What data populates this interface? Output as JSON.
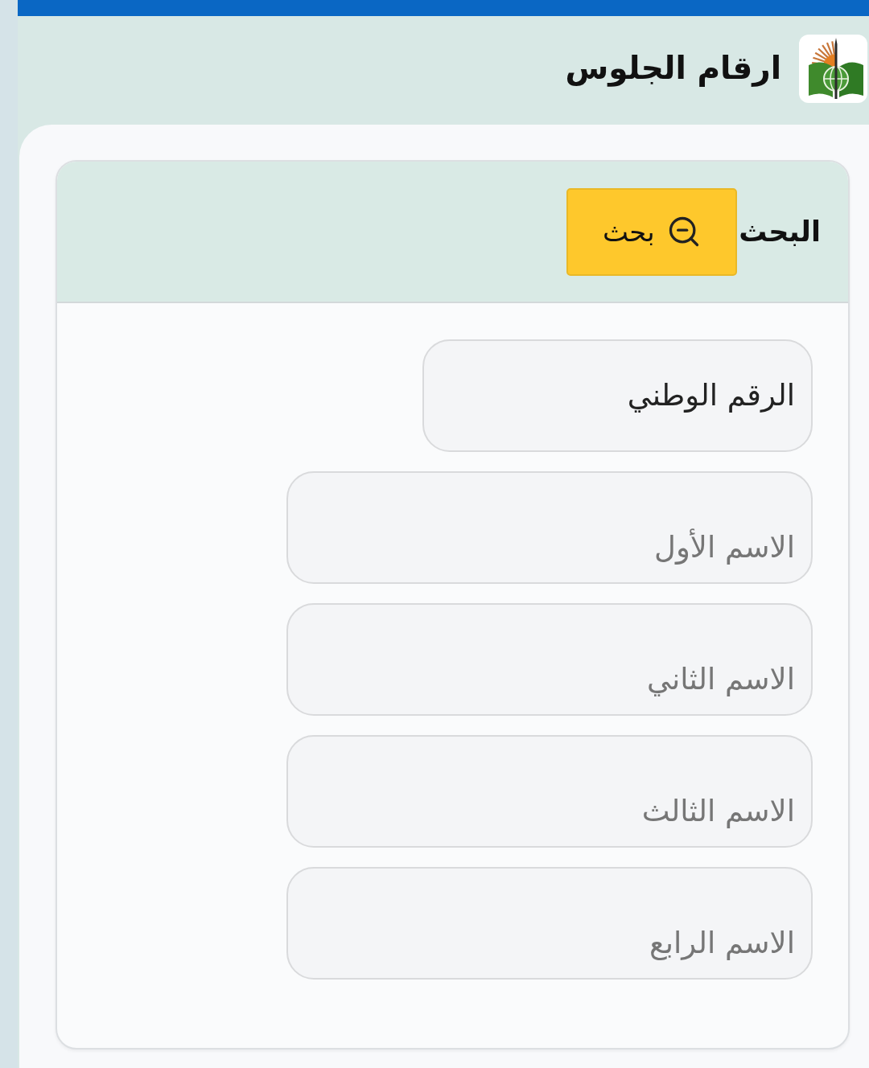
{
  "header": {
    "title": "ارقام الجلوس"
  },
  "search_card": {
    "title": "البحث",
    "button": {
      "label": "بحث"
    }
  },
  "fields": [
    {
      "kind": "select",
      "value": "الرقم الوطني"
    },
    {
      "kind": "text",
      "placeholder": "الاسم الأول"
    },
    {
      "kind": "text",
      "placeholder": "الاسم الثاني"
    },
    {
      "kind": "text",
      "placeholder": "الاسم الثالث"
    },
    {
      "kind": "text",
      "placeholder": "الاسم الرابع"
    }
  ]
}
